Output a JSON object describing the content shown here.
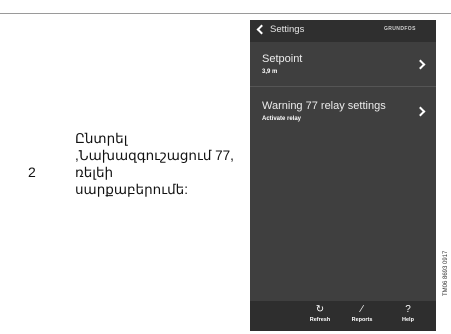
{
  "step": {
    "number": "2",
    "instruction": "Ընտրել\n,Նախազգուշացում 77,\nռելեի\nսարքաբերումե:"
  },
  "phone": {
    "header": {
      "title": "Settings",
      "brand": "GRUNDFOS"
    },
    "items": [
      {
        "title": "Setpoint",
        "subtitle": "3,9 m"
      },
      {
        "title": "Warning 77 relay settings",
        "subtitle": "Activate relay"
      }
    ],
    "toolbar": {
      "refresh_label": "Refresh",
      "reports_label": "Reports",
      "help_label": "Help"
    }
  },
  "document_id": "TM06 8693 0917",
  "icons": {
    "back": "chevron-left-icon",
    "refresh": "refresh-icon",
    "reports": "pencil-icon",
    "help": "question-mark-icon",
    "item_arrow": "chevron-right-icon"
  }
}
